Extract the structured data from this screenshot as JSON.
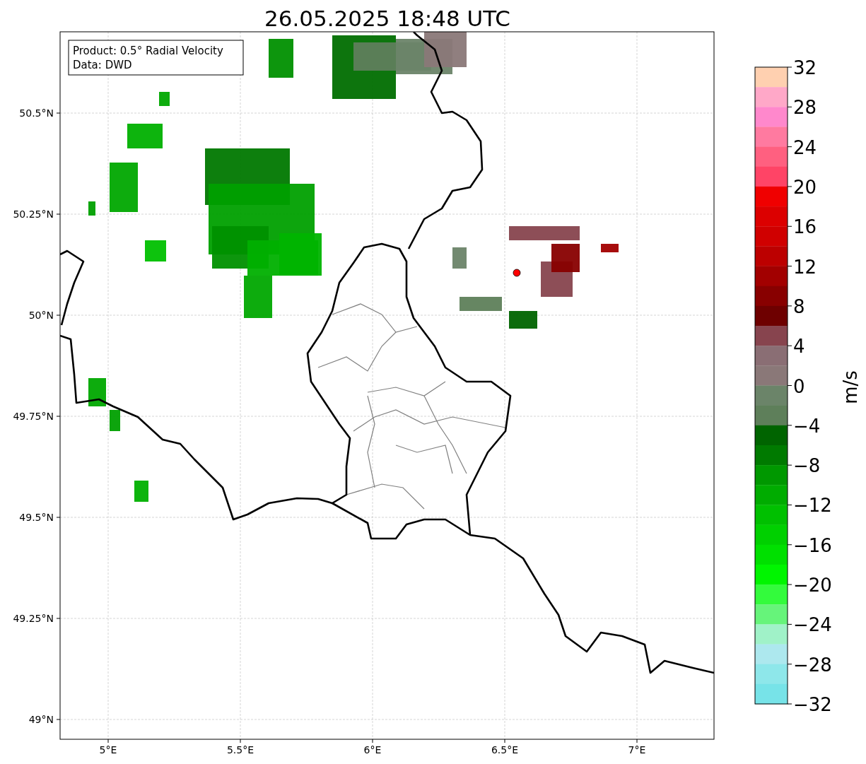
{
  "title": "26.05.2025 18:48 UTC",
  "info_box": {
    "lines": [
      "Product: 0.5° Radial Velocity",
      "Data: DWD"
    ]
  },
  "map": {
    "y_ticks": [
      "50.5°N",
      "50.25°N",
      "50°N",
      "49.75°N",
      "49.5°N",
      "49.25°N",
      "49°N"
    ],
    "x_ticks": [
      "5°E",
      "5.5°E",
      "6°E",
      "6.5°E",
      "7°E"
    ]
  },
  "colorbar": {
    "label": "m/s",
    "ticks": [
      "32",
      "28",
      "24",
      "20",
      "16",
      "12",
      "8",
      "4",
      "0",
      "−4",
      "−8",
      "−12",
      "−16",
      "−20",
      "−24",
      "−28",
      "−32"
    ],
    "bands": [
      {
        "color": "#ffd0b0"
      },
      {
        "color": "#ffa8c8"
      },
      {
        "color": "#ff88cc"
      },
      {
        "color": "#ff7aa0"
      },
      {
        "color": "#ff6080"
      },
      {
        "color": "#ff4466"
      },
      {
        "color": "#f00000"
      },
      {
        "color": "#dc0000"
      },
      {
        "color": "#d00000"
      },
      {
        "color": "#bc0000"
      },
      {
        "color": "#a20000"
      },
      {
        "color": "#880000"
      },
      {
        "color": "#6e0000"
      },
      {
        "color": "#87444e"
      },
      {
        "color": "#8a6e74"
      },
      {
        "color": "#8a7878"
      },
      {
        "color": "#6b8469"
      },
      {
        "color": "#5e7f5a"
      },
      {
        "color": "#006400"
      },
      {
        "color": "#007a00"
      },
      {
        "color": "#009800"
      },
      {
        "color": "#00ac00"
      },
      {
        "color": "#00c000"
      },
      {
        "color": "#00d000"
      },
      {
        "color": "#00e000"
      },
      {
        "color": "#00f500"
      },
      {
        "color": "#33fb3c"
      },
      {
        "color": "#66f47a"
      },
      {
        "color": "#a0f2c8"
      },
      {
        "color": "#ade8ee"
      },
      {
        "color": "#8ee7ea"
      },
      {
        "color": "#77e3e8"
      }
    ]
  }
}
